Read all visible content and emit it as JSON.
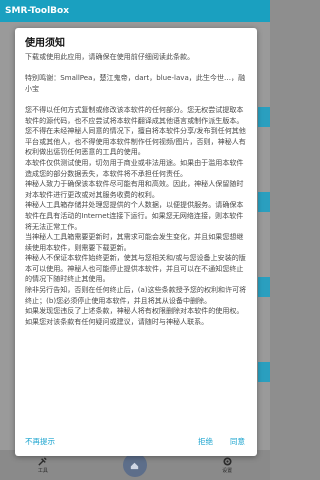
{
  "app": {
    "title": "SMR-ToolBox",
    "nav_items": [
      {
        "icon": "tools-icon",
        "label": "工具"
      },
      {
        "icon": "home-icon",
        "label": ""
      },
      {
        "icon": "gear-icon",
        "label": "设置"
      }
    ]
  },
  "dialog": {
    "title": "使用须知",
    "paragraphs": [
      "下载或使用此应用，请确保在使用前仔细阅读此条款。",
      "",
      "特别鸣谢：SmallPea，楚江鬼帝，dart，blue-lava，此生今世…，融小宝",
      "",
      "您不得以任何方式复制或修改该本软件的任何部分。您无权尝试提取本软件的源代码，也不应尝试将本软件翻译成其他语言或制作派生版本。",
      "您不得在未经神秘人同意的情况下，擅自将本软件分享/发布到任何其他平台或其他人，也不得使用本软件制作任何视频/图片，否则，神秘人有权利做出惩罚任何恶意的工具的使用。",
      "本软件仅供测试使用，切勿用于商业或非法用途。如果由于滥用本软件造成您的部分数据丢失，本软件将不承担任何责任。",
      "神秘人致力于确保该本软件尽可能有用和高效。因此，神秘人保留随时对本软件进行更改或对其服务收费的权利。",
      "神秘人工具箱存储并处理您提供的个人数据，以便提供服务。请确保本软件在具有活动的Internet连接下运行。如果您无网络连接，则本软件将无法正常工作。",
      "当神秘人工具箱需要更新时，其需求可能会发生变化，并且如果您想继续使用本软件，则需要下载更新。",
      "神秘人不保证本软件始终更新，使其与您相关和/或与您设备上安装的版本可以使用。神秘人也可能停止提供本软件，并且可以在不通知您终止的情况下随时终止其使用。",
      "除非另行告知，否则在任何终止后，(a)这些条款授予您的权利和许可将终止；(b)您必须停止使用本软件，并且将其从设备中删除。",
      "如果发现您违反了上述条款，神秘人将有权限删除对本软件的使用权。",
      "如果您对该条款有任何疑问或建议，请随时与神秘人联系。"
    ],
    "buttons": {
      "no_remind": "不再提示",
      "reject": "拒绝",
      "agree": "同意"
    }
  },
  "colors": {
    "appbar": "#1aa0c0",
    "statusbar": "#0f6f88",
    "accent_button": "#1ba4cf",
    "scrim": "#8e8e8e"
  }
}
